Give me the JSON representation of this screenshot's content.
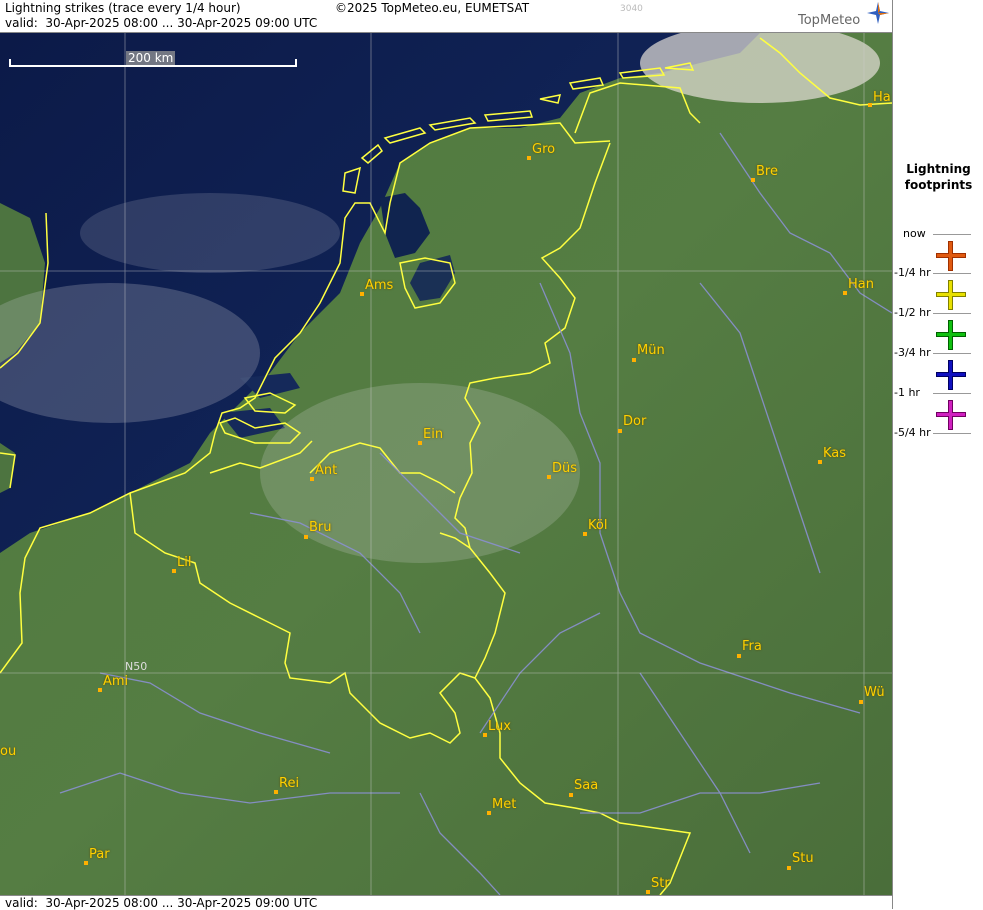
{
  "header": {
    "title": "Lightning strikes (trace every 1/4 hour)",
    "copyright": "©2025 TopMeteo.eu, EUMETSAT",
    "code": "3040",
    "valid": "valid:  30-Apr-2025 08:00 ... 30-Apr-2025 09:00 UTC",
    "brand": "TopMeteo"
  },
  "footer": {
    "valid": "valid:  30-Apr-2025 08:00 ... 30-Apr-2025 09:00 UTC"
  },
  "map": {
    "scale_label": "200 km",
    "grid_label": "N50",
    "cities": [
      {
        "name": "Gro"
      },
      {
        "name": "Bre"
      },
      {
        "name": "Ha"
      },
      {
        "name": "Ams"
      },
      {
        "name": "Han"
      },
      {
        "name": "Mün"
      },
      {
        "name": "Dor"
      },
      {
        "name": "Ein"
      },
      {
        "name": "Kas"
      },
      {
        "name": "Ant"
      },
      {
        "name": "Düs"
      },
      {
        "name": "Bru"
      },
      {
        "name": "Köl"
      },
      {
        "name": "Lil"
      },
      {
        "name": "Fra"
      },
      {
        "name": "Ami"
      },
      {
        "name": "Wü"
      },
      {
        "name": "Lux"
      },
      {
        "name": "ou"
      },
      {
        "name": "Rei"
      },
      {
        "name": "Saa"
      },
      {
        "name": "Met"
      },
      {
        "name": "Par"
      },
      {
        "name": "Stu"
      },
      {
        "name": "Str"
      }
    ]
  },
  "legend": {
    "title_line1": "Lightning",
    "title_line2": "footprints",
    "items": [
      {
        "label": "now",
        "color": "#e05a10"
      },
      {
        "label": "-1/4 hr",
        "color": "#e8e000"
      },
      {
        "label": "-1/2 hr",
        "color": "#10c010"
      },
      {
        "label": "-3/4 hr",
        "color": "#1010c0"
      },
      {
        "label": "-1 hr",
        "color": "#d020c0"
      },
      {
        "label": "-5/4 hr",
        "color": ""
      }
    ]
  }
}
